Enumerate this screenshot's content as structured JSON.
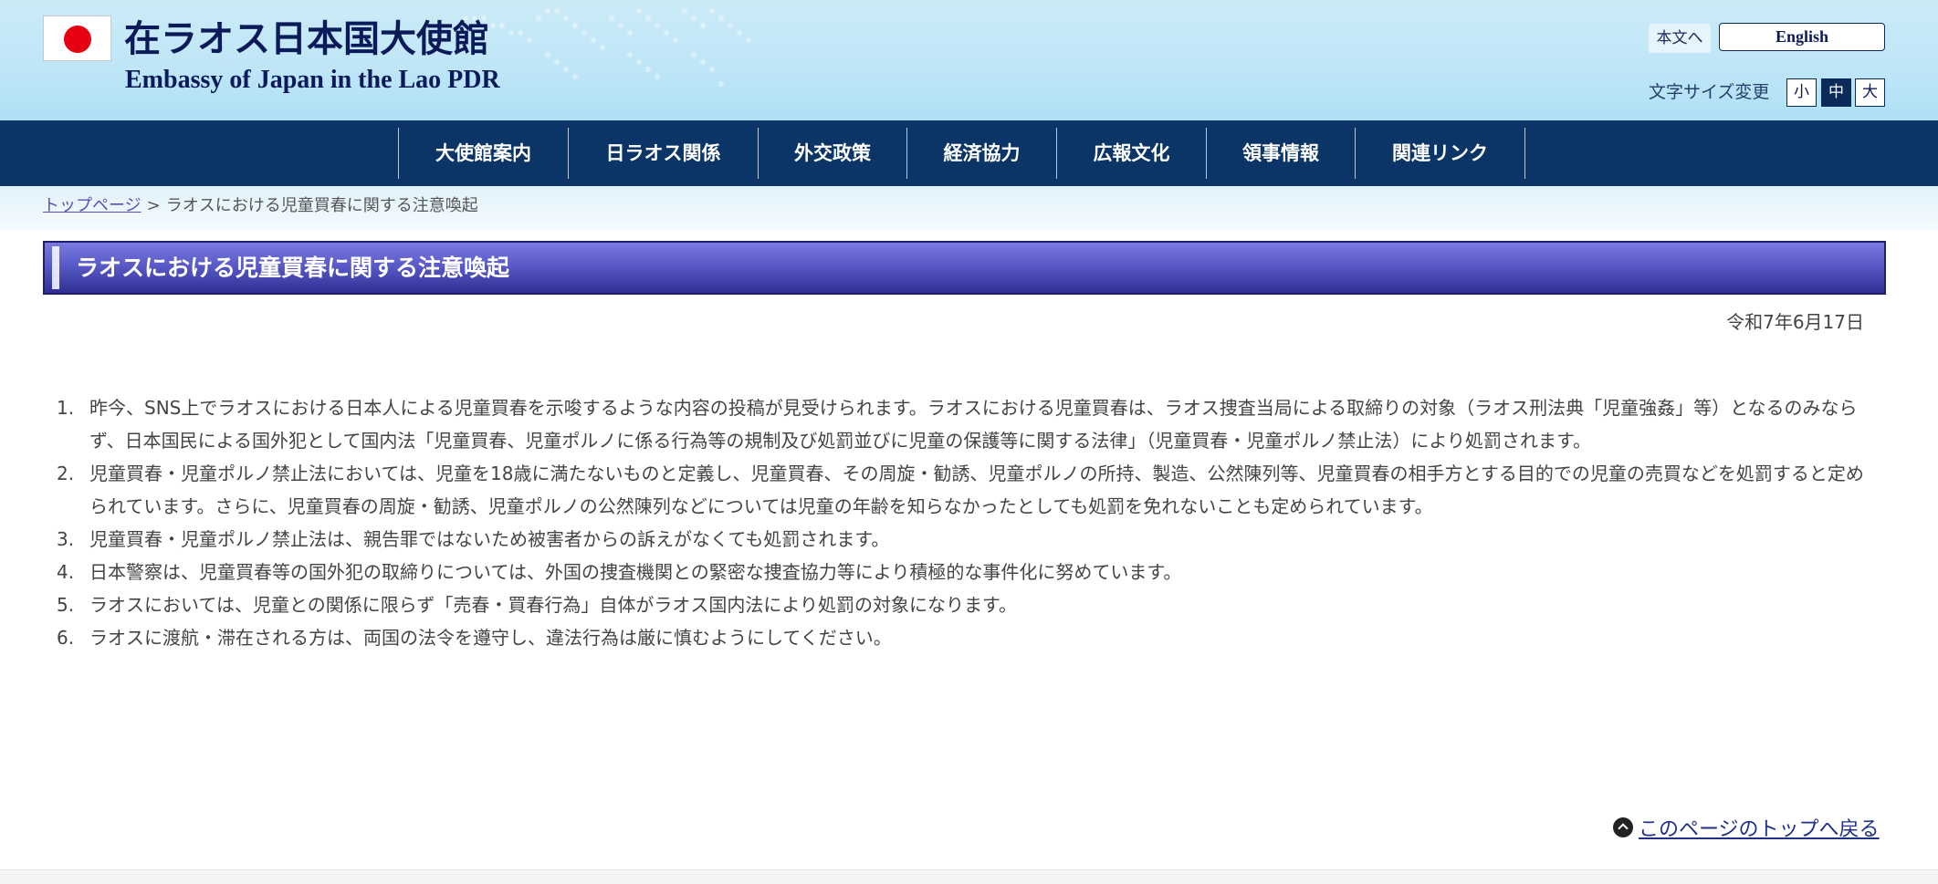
{
  "header": {
    "title_jp": "在ラオス日本国大使館",
    "title_en": "Embassy of Japan in the Lao PDR",
    "skip_link": "本文へ",
    "english_button": "English",
    "font_size_label": "文字サイズ変更",
    "font_size_small": "小",
    "font_size_medium": "中",
    "font_size_large": "大"
  },
  "nav": {
    "items": [
      {
        "label": "大使館案内"
      },
      {
        "label": "日ラオス関係"
      },
      {
        "label": "外交政策"
      },
      {
        "label": "経済協力"
      },
      {
        "label": "広報文化"
      },
      {
        "label": "領事情報"
      },
      {
        "label": "関連リンク"
      }
    ]
  },
  "breadcrumb": {
    "home": "トップページ",
    "separator": ">",
    "current": "ラオスにおける児童買春に関する注意喚起"
  },
  "page": {
    "heading": "ラオスにおける児童買春に関する注意喚起",
    "date": "令和7年6月17日",
    "items": [
      {
        "num": "1.",
        "text": "昨今、SNS上でラオスにおける日本人による児童買春を示唆するような内容の投稿が見受けられます。ラオスにおける児童買春は、ラオス捜査当局による取締りの対象（ラオス刑法典「児童強姦」等）となるのみならず、日本国民による国外犯として国内法「児童買春、児童ポルノに係る行為等の規制及び処罰並びに児童の保護等に関する法律」（児童買春・児童ポルノ禁止法）により処罰されます。"
      },
      {
        "num": "2.",
        "text": "児童買春・児童ポルノ禁止法においては、児童を18歳に満たないものと定義し、児童買春、その周旋・勧誘、児童ポルノの所持、製造、公然陳列等、児童買春の相手方とする目的での児童の売買などを処罰すると定められています。さらに、児童買春の周旋・勧誘、児童ポルノの公然陳列などについては児童の年齢を知らなかったとしても処罰を免れないことも定められています。"
      },
      {
        "num": "3.",
        "text": "児童買春・児童ポルノ禁止法は、親告罪ではないため被害者からの訴えがなくても処罰されます。"
      },
      {
        "num": "4.",
        "text": "日本警察は、児童買春等の国外犯の取締りについては、外国の捜査機関との緊密な捜査協力等により積極的な事件化に努めています。"
      },
      {
        "num": "5.",
        "text": "ラオスにおいては、児童との関係に限らず「売春・買春行為」自体がラオス国内法により処罰の対象になります。"
      },
      {
        "num": "6.",
        "text": "ラオスに渡航・滞在される方は、両国の法令を遵守し、違法行為は厳に慎むようにしてください。"
      }
    ],
    "back_to_top": "このページのトップへ戻る"
  },
  "colors": {
    "nav_bg": "#0b3566",
    "heading_bar": "#5a5ac8",
    "title_text": "#0b1b5a",
    "flag_red": "#e60012"
  }
}
